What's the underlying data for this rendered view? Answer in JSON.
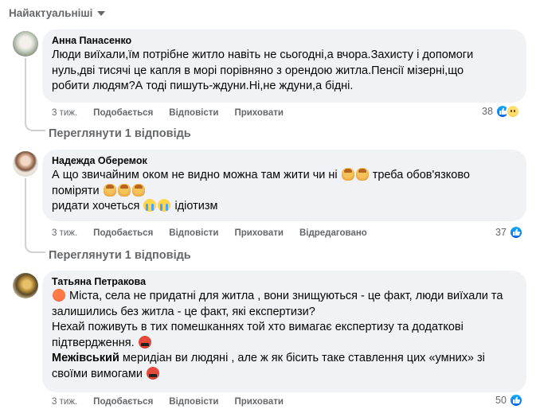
{
  "sort": {
    "label": "Найактуальніші"
  },
  "comments": [
    {
      "author": "Анна Панасенко",
      "lines": [
        "Люди виїхали,їм потрібне житло навіть не сьогодні,а вчора.Захисту і допомоги",
        "нуль,дві тисячі це капля в морі порівняно з орендою житла.Пенсії мізерні,що",
        "робити людям?А тоді пишуть-ждуни.Ні,не ждуни,а бідні."
      ],
      "time": "3 тиж.",
      "like": "Подобається",
      "reply": "Відповісти",
      "hide": "Приховати",
      "reaction_count": "38",
      "view_replies": "Переглянути 1 відповідь"
    },
    {
      "author": "Надежда Оберемок",
      "line1": "А що звичайним оком не видно можна там жити чи ні",
      "line1b": "треба обов'язково",
      "line2": "поміряти",
      "line3": "ридати хочеться",
      "line3b": "ідіотизм",
      "time": "3 тиж.",
      "like": "Подобається",
      "reply": "Відповісти",
      "hide": "Приховати",
      "edited": "Відредаговано",
      "reaction_count": "37",
      "view_replies": "Переглянути 1 відповідь"
    },
    {
      "author": "Татьяна Петракова",
      "line1": "Міста, села не придатні для житла , вони знищуються - це факт, люди виїхали та",
      "line2": "залишились без житла - це факт, які експертизи?",
      "line3": "Нехай поживуть в тих помешканнях той хто вимагає експертизу та додаткові",
      "line4": "підтвердження.",
      "line5_bold": "Межівський",
      "line5": " меридіан ви людяні , але ж як бісить таке ставлення цих «умних» зі",
      "line6": "своїми вимогами",
      "time": "3 тиж.",
      "like": "Подобається",
      "reply": "Відповісти",
      "hide": "Приховати",
      "reaction_count": "50"
    }
  ],
  "colors": {
    "bubble": "#f0f2f5",
    "secondary_text": "#65676b",
    "like_blue": "#0165e1"
  }
}
